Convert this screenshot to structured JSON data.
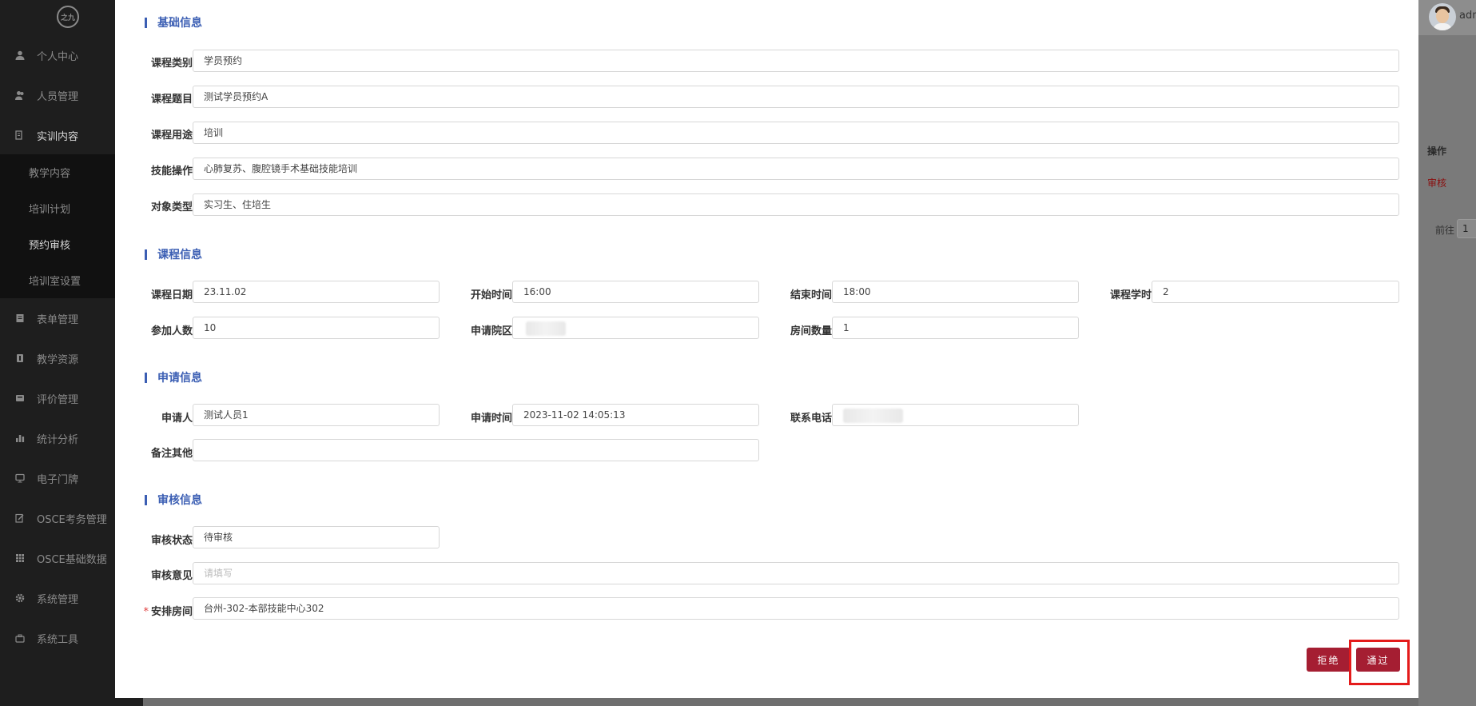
{
  "sidebar": {
    "logo_text": "之九",
    "items": [
      {
        "label": "个人中心",
        "icon": "user-icon"
      },
      {
        "label": "人员管理",
        "icon": "users-icon"
      },
      {
        "label": "实训内容",
        "icon": "book-icon"
      },
      {
        "label": "表单管理",
        "icon": "form-icon"
      },
      {
        "label": "教学资源",
        "icon": "resource-icon"
      },
      {
        "label": "评价管理",
        "icon": "evaluate-icon"
      },
      {
        "label": "统计分析",
        "icon": "bar-chart-icon"
      },
      {
        "label": "电子门牌",
        "icon": "monitor-icon"
      },
      {
        "label": "OSCE考务管理",
        "icon": "edit-icon"
      },
      {
        "label": "OSCE基础数据",
        "icon": "grid-icon"
      },
      {
        "label": "系统管理",
        "icon": "gear-icon"
      },
      {
        "label": "系统工具",
        "icon": "toolbox-icon"
      }
    ],
    "sub_items": [
      {
        "label": "教学内容"
      },
      {
        "label": "培训计划"
      },
      {
        "label": "预约审核"
      },
      {
        "label": "培训室设置"
      }
    ]
  },
  "header": {
    "user": "adm"
  },
  "background_table": {
    "op_header": "操作",
    "op_link": "审核",
    "goto_label": "前往",
    "goto_value": "1"
  },
  "sections": {
    "basic": "基础信息",
    "course": "课程信息",
    "apply": "申请信息",
    "review": "审核信息"
  },
  "basic": {
    "category_label": "课程类别",
    "category": "学员预约",
    "topic_label": "课程题目",
    "topic": "测试学员预约A",
    "purpose_label": "课程用途",
    "purpose": "培训",
    "skill_label": "技能操作",
    "skill": "心肺复苏、腹腔镜手术基础技能培训",
    "target_label": "对象类型",
    "target": "实习生、住培生"
  },
  "course": {
    "date_label": "课程日期",
    "date": "23.11.02",
    "start_label": "开始时间",
    "start": "16:00",
    "end_label": "结束时间",
    "end": "18:00",
    "hours_label": "课程学时",
    "hours": "2",
    "count_label": "参加人数",
    "count": "10",
    "campus_label": "申请院区",
    "rooms_label": "房间数量",
    "rooms": "1"
  },
  "apply": {
    "applicant_label": "申请人",
    "applicant": "测试人员1",
    "time_label": "申请时间",
    "time": "2023-11-02 14:05:13",
    "phone_label": "联系电话",
    "remark_label": "备注其他",
    "remark": ""
  },
  "review": {
    "status_label": "审核状态",
    "status": "待审核",
    "opinion_label": "审核意见",
    "opinion_placeholder": "请填写",
    "room_required": "*",
    "room_label": "安排房间",
    "room": "台州-302-本部技能中心302"
  },
  "actions": {
    "reject": "拒绝",
    "approve": "通过"
  }
}
